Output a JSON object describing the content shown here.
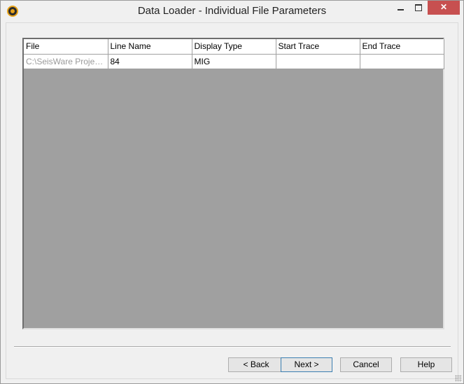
{
  "window": {
    "title": "Data Loader - Individual File Parameters",
    "icon": "seisware-logo-icon",
    "controls": {
      "minimize": "minimize-icon",
      "maximize": "maximize-icon",
      "close": "✕"
    }
  },
  "table": {
    "columns": [
      "File",
      "Line Name",
      "Display Type",
      "Start Trace",
      "End Trace"
    ],
    "rows": [
      {
        "file": "C:\\SeisWare Project...",
        "line_name": "84",
        "display_type": "MIG",
        "start_trace": "",
        "end_trace": ""
      }
    ]
  },
  "buttons": {
    "back": "< Back",
    "next": "Next >",
    "cancel": "Cancel",
    "help": "Help"
  }
}
